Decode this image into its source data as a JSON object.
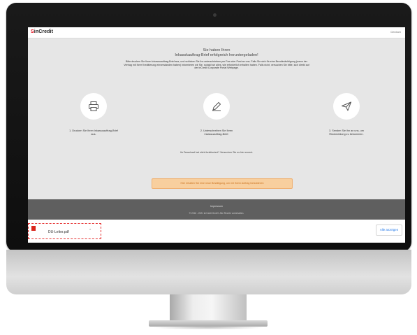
{
  "header": {
    "logo_mark": "S",
    "logo_text": "inCredit",
    "top_right": "Deutsch"
  },
  "intro": {
    "title_line1": "Sie haben Ihren",
    "title_line2": "Inkasskauftrag-Brief erfolgreich heruntergeladen!",
    "description": "Bitte drucken Sie Ihren Inkassoauftrag-Brief aus, und schicken Sie ihn unterschrieben per Fax oder Post an uns. Falls Sie sich für eine Bevollmächtigung (wenn der Vertrag mit Ihrer Kreditierung einverstanden haben) informieren wir Sie, sobald wir alles, wie erforderlich erhalten haben. Falls nicht, versuchen Sie bitte, sich direkt auf der inCredit Corporate Portal Webpage."
  },
  "steps": [
    {
      "icon": "printer-icon",
      "text": "1. Drucken Sie Ihren Inkassoauftrag-Brief aus."
    },
    {
      "icon": "pen-icon",
      "text": "2. Unterschreiben Sie Ihren Inkassoauftrag-Brief."
    },
    {
      "icon": "paper-plane-icon",
      "text": "3. Senden Sie ihn an uns, um Rückmeldung zu bekommen."
    }
  ],
  "question": "Ihr Download hat nicht funktioniert? Versuchen Sie es hier erneut.",
  "notice": "Hier erhalten Sie eine neue Bestätigung, um mit Ihrem Auftrag fortzufahren",
  "footer": {
    "link": "Impressum",
    "copyright": "© 2016 - 2021 inCredit GmbH. Alle Rechte vorbehalten."
  },
  "download_bar": {
    "file_name": "DU-Letter.pdf",
    "show_all": "Alle anzeigen"
  },
  "colors": {
    "brand_red": "#e30613",
    "notice_bg": "#f8cf9e",
    "footer_bg": "#5f5f5f",
    "link_blue": "#1a73e8"
  }
}
